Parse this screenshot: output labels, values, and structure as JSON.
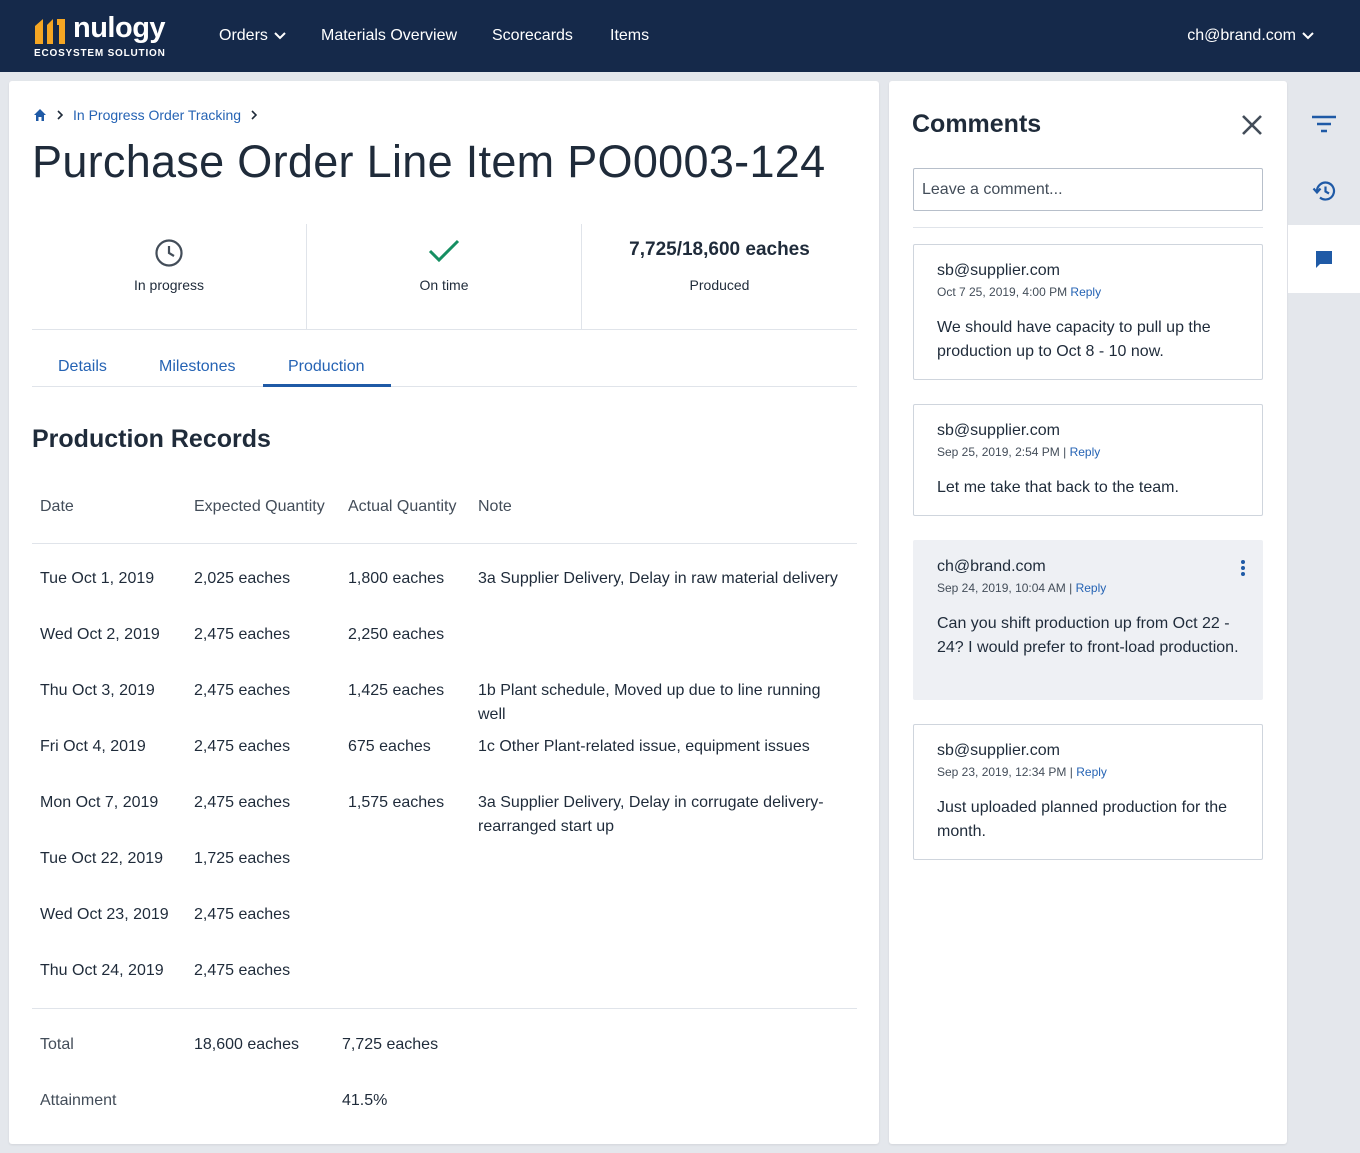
{
  "nav": {
    "logo_word": "nulogy",
    "logo_sub": "ECOSYSTEM SOLUTION",
    "items": [
      "Orders",
      "Materials Overview",
      "Scorecards",
      "Items"
    ],
    "user": "ch@brand.com"
  },
  "breadcrumb": {
    "link": "In Progress Order Tracking"
  },
  "page": {
    "title": "Purchase Order Line Item PO0003-124"
  },
  "stats": {
    "status": "In progress",
    "timeliness": "On time",
    "produced_value": "7,725/18,600 eaches",
    "produced_label": "Produced"
  },
  "tabs": [
    "Details",
    "Milestones",
    "Production"
  ],
  "production": {
    "title": "Production Records",
    "headers": [
      "Date",
      "Expected Quantity",
      "Actual Quantity",
      "Note"
    ],
    "rows": [
      {
        "date": "Tue Oct 1, 2019",
        "expected": "2,025 eaches",
        "actual": "1,800 eaches",
        "note": "3a Supplier Delivery, Delay in raw material delivery"
      },
      {
        "date": "Wed Oct 2, 2019",
        "expected": "2,475 eaches",
        "actual": "2,250 eaches",
        "note": ""
      },
      {
        "date": "Thu Oct 3, 2019",
        "expected": "2,475 eaches",
        "actual": "1,425 eaches",
        "note": "1b  Plant schedule, Moved up due to line running well"
      },
      {
        "date": "Fri Oct 4, 2019",
        "expected": "2,475 eaches",
        "actual": "675 eaches",
        "note": "1c  Other Plant-related issue, equipment issues"
      },
      {
        "date": "Mon Oct 7, 2019",
        "expected": "2,475 eaches",
        "actual": "1,575 eaches",
        "note": "3a Supplier Delivery, Delay in corrugate delivery- rearranged start up"
      },
      {
        "date": "Tue Oct 22, 2019",
        "expected": "1,725 eaches",
        "actual": "",
        "note": ""
      },
      {
        "date": "Wed Oct 23, 2019",
        "expected": "2,475 eaches",
        "actual": "",
        "note": ""
      },
      {
        "date": "Thu Oct 24, 2019",
        "expected": "2,475 eaches",
        "actual": "",
        "note": ""
      }
    ],
    "total_label": "Total",
    "total_expected": "18,600 eaches",
    "total_actual": "7,725 eaches",
    "attainment_label": "Attainment",
    "attainment_value": "41.5%"
  },
  "comments": {
    "title": "Comments",
    "placeholder": "Leave a comment...",
    "reply_label": "Reply",
    "items": [
      {
        "author": "sb@supplier.com",
        "meta": "Oct 7 25, 2019, 4:00 PM",
        "text": "We should have capacity to pull up the production up to Oct 8 - 10 now."
      },
      {
        "author": "sb@supplier.com",
        "meta": "Sep 25, 2019, 2:54 PM |",
        "text": "Let me take that back to the team."
      },
      {
        "author": "ch@brand.com",
        "meta": "Sep 24, 2019, 10:04 AM |",
        "text": "Can you shift production up from Oct 22 - 24? I would prefer to front-load production."
      },
      {
        "author": "sb@supplier.com",
        "meta": "Sep 23, 2019, 12:34 PM |",
        "text": "Just uploaded planned production for the month."
      }
    ]
  },
  "colors": {
    "topbar": "#15294a",
    "accent": "#2563b4",
    "logo_mark": "#f5a623",
    "success": "#168f62"
  },
  "icons": {
    "home": "home-icon",
    "clock": "clock-icon",
    "check": "check-icon",
    "close": "close-icon",
    "filter": "filter-icon",
    "history": "history-icon",
    "comment": "comment-icon",
    "kebab": "more-vertical-icon"
  }
}
